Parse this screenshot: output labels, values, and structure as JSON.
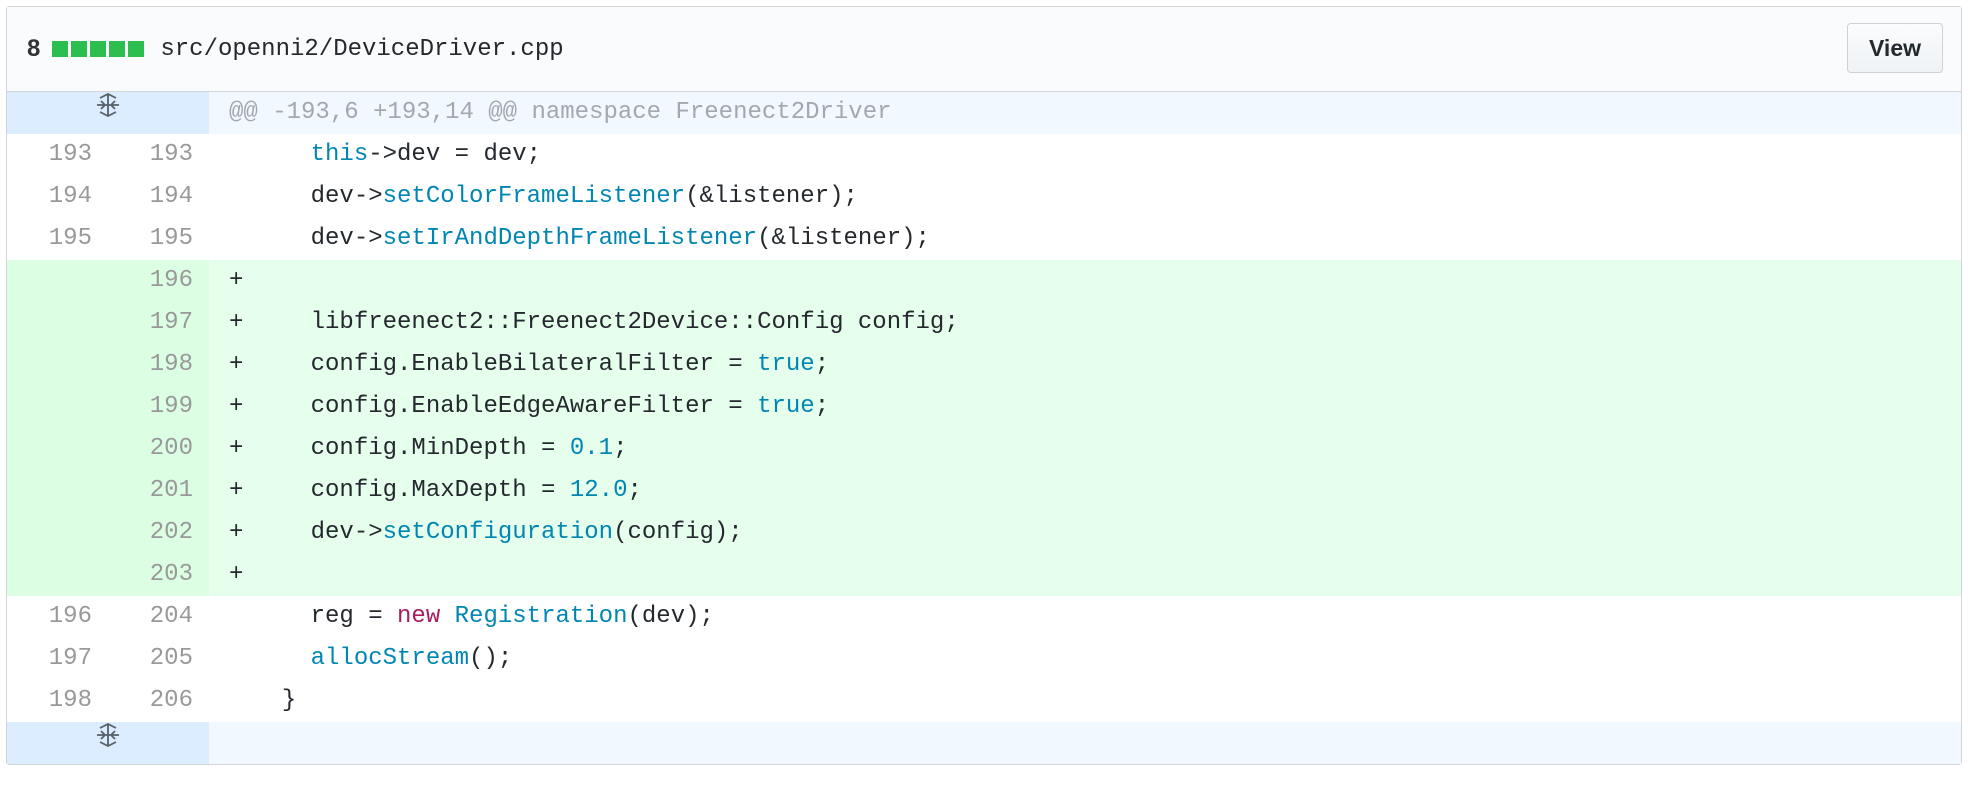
{
  "header": {
    "diffstat_count": "8",
    "file_path": "src/openni2/DeviceDriver.cpp",
    "view_label": "View",
    "added_color": "#2cbe4e"
  },
  "hunk": {
    "header_text": "@@ -193,6 +193,14 @@ namespace Freenect2Driver",
    "expand_icon": "unfold-icon"
  },
  "lines": [
    {
      "old": "193",
      "new": "193",
      "type": "context",
      "marker": " ",
      "indent": "    ",
      "parts": [
        [
          "kw",
          "this"
        ],
        [
          "",
          "->dev = dev;"
        ]
      ]
    },
    {
      "old": "194",
      "new": "194",
      "type": "context",
      "marker": " ",
      "indent": "    ",
      "parts": [
        [
          "",
          "dev->"
        ],
        [
          "fn",
          "setColorFrameListener"
        ],
        [
          "",
          "(&listener);"
        ]
      ]
    },
    {
      "old": "195",
      "new": "195",
      "type": "context",
      "marker": " ",
      "indent": "    ",
      "parts": [
        [
          "",
          "dev->"
        ],
        [
          "fn",
          "setIrAndDepthFrameListener"
        ],
        [
          "",
          "(&listener);"
        ]
      ]
    },
    {
      "old": "",
      "new": "196",
      "type": "added",
      "marker": "+",
      "indent": "",
      "parts": []
    },
    {
      "old": "",
      "new": "197",
      "type": "added",
      "marker": "+",
      "indent": "    ",
      "parts": [
        [
          "",
          "libfreenect2::Freenect2Device::Config config;"
        ]
      ]
    },
    {
      "old": "",
      "new": "198",
      "type": "added",
      "marker": "+",
      "indent": "    ",
      "parts": [
        [
          "",
          "config.EnableBilateralFilter = "
        ],
        [
          "bool",
          "true"
        ],
        [
          "",
          ";"
        ]
      ]
    },
    {
      "old": "",
      "new": "199",
      "type": "added",
      "marker": "+",
      "indent": "    ",
      "parts": [
        [
          "",
          "config.EnableEdgeAwareFilter = "
        ],
        [
          "bool",
          "true"
        ],
        [
          "",
          ";"
        ]
      ]
    },
    {
      "old": "",
      "new": "200",
      "type": "added",
      "marker": "+",
      "indent": "    ",
      "parts": [
        [
          "",
          "config.MinDepth = "
        ],
        [
          "numv",
          "0.1"
        ],
        [
          "",
          ";"
        ]
      ]
    },
    {
      "old": "",
      "new": "201",
      "type": "added",
      "marker": "+",
      "indent": "    ",
      "parts": [
        [
          "",
          "config.MaxDepth = "
        ],
        [
          "numv",
          "12.0"
        ],
        [
          "",
          ";"
        ]
      ]
    },
    {
      "old": "",
      "new": "202",
      "type": "added",
      "marker": "+",
      "indent": "    ",
      "parts": [
        [
          "",
          "dev->"
        ],
        [
          "fn",
          "setConfiguration"
        ],
        [
          "",
          "(config);"
        ]
      ]
    },
    {
      "old": "",
      "new": "203",
      "type": "added",
      "marker": "+",
      "indent": "",
      "parts": []
    },
    {
      "old": "196",
      "new": "204",
      "type": "context",
      "marker": " ",
      "indent": "    ",
      "parts": [
        [
          "",
          "reg = "
        ],
        [
          "new-kw",
          "new"
        ],
        [
          "",
          " "
        ],
        [
          "class",
          "Registration"
        ],
        [
          "",
          "(dev);"
        ]
      ]
    },
    {
      "old": "197",
      "new": "205",
      "type": "context",
      "marker": " ",
      "indent": "    ",
      "parts": [
        [
          "fn",
          "allocStream"
        ],
        [
          "",
          "();"
        ]
      ]
    },
    {
      "old": "198",
      "new": "206",
      "type": "context",
      "marker": " ",
      "indent": "  ",
      "parts": [
        [
          "",
          "}"
        ]
      ]
    }
  ]
}
